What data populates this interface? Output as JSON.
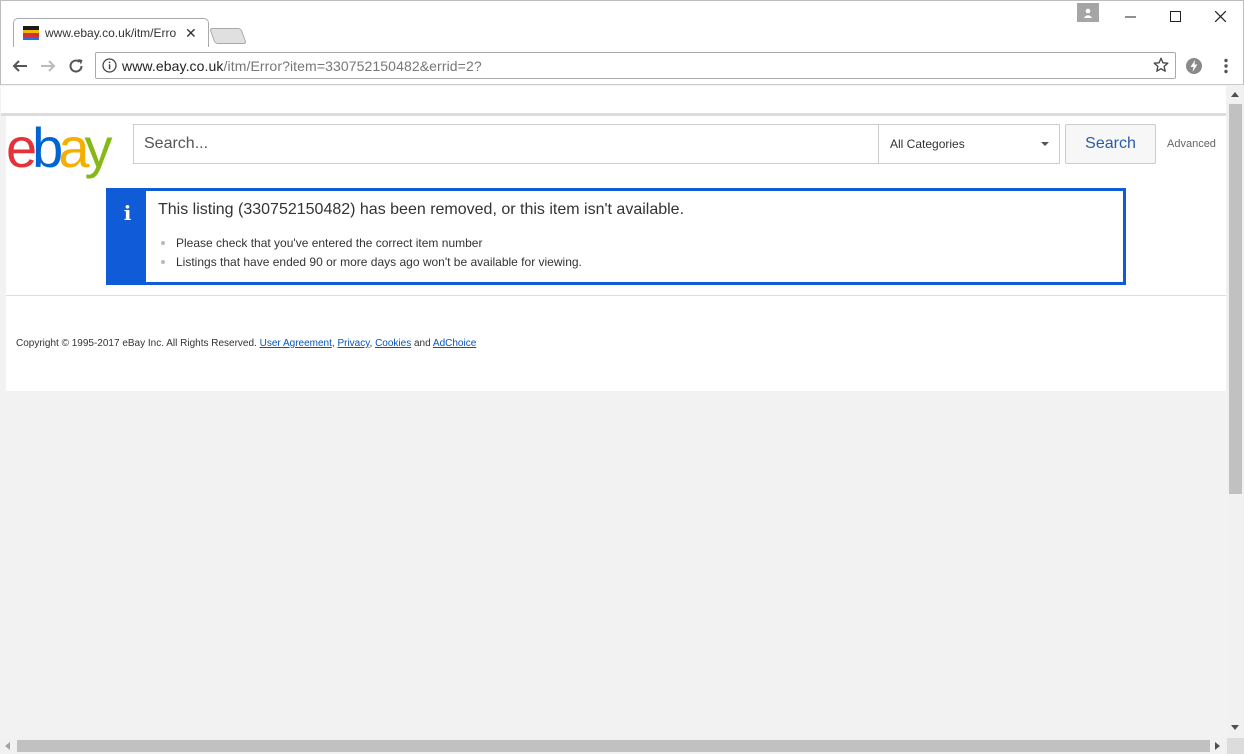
{
  "browser": {
    "tab_title": "www.ebay.co.uk/itm/Erro",
    "tab_close": "✕",
    "url_host": "www.ebay.co.uk",
    "url_path": "/itm/Error?item=330752150482&errid=2?",
    "window_controls": {
      "minimize": "—",
      "maximize": "☐",
      "close": "✕"
    },
    "favicon_colors": [
      "#1a1a1a",
      "#f2b705",
      "#d93025",
      "#1a73e8"
    ]
  },
  "header": {
    "logo": {
      "e": "e",
      "b": "b",
      "a": "a",
      "y": "y"
    },
    "search_placeholder": "Search...",
    "category_selected": "All Categories",
    "search_button": "Search",
    "advanced_link": "Advanced"
  },
  "alert": {
    "icon": "i",
    "title": "This listing (330752150482) has been removed, or this item isn't available.",
    "items": [
      "Please check that you've entered the correct item number",
      "Listings that have ended 90 or more days ago won't be available for viewing."
    ]
  },
  "footer": {
    "copyright": "Copyright © 1995-2017 eBay Inc. All Rights Reserved.",
    "links": [
      "User Agreement",
      "Privacy",
      "Cookies",
      "AdChoice"
    ],
    "separator": ",",
    "and": "and"
  },
  "colors": {
    "alert_blue": "#0f5bd8",
    "link": "#0654ba",
    "logo_e": "#e53238",
    "logo_b": "#0064d2",
    "logo_a": "#f5af02",
    "logo_y": "#86b817"
  },
  "icons": [
    "back-arrow-icon",
    "forward-arrow-icon",
    "reload-icon",
    "info-icon",
    "star-icon",
    "extension-icon",
    "menu-dots-icon",
    "profile-icon"
  ]
}
